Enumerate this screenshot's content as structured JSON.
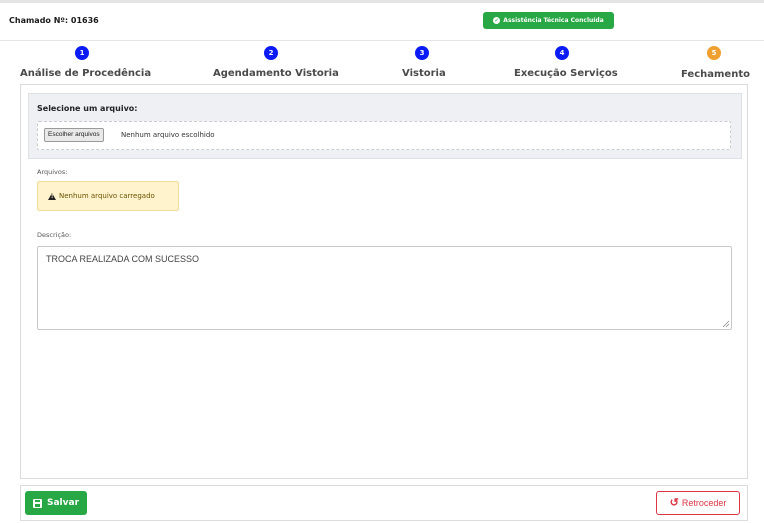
{
  "header": {
    "chamado": "Chamado Nº: 01636",
    "status_badge": "Assistência Técnica Concluída"
  },
  "steps": [
    {
      "number": "1",
      "label": "Análise de Procedência",
      "color": "#0a1bf5"
    },
    {
      "number": "2",
      "label": "Agendamento Vistoria",
      "color": "#0a1bf5"
    },
    {
      "number": "3",
      "label": "Vistoria",
      "color": "#0a1bf5"
    },
    {
      "number": "4",
      "label": "Execução Serviços",
      "color": "#0a1bf5"
    },
    {
      "number": "5",
      "label": "Fechamento",
      "color": "#f0a030"
    }
  ],
  "upload": {
    "title": "Selecione um arquivo:",
    "button_label": "Escolher arquivos",
    "file_status": "Nenhum arquivo escolhido"
  },
  "files": {
    "label": "Arquivos:",
    "empty_message": "Nenhum arquivo carregado"
  },
  "description": {
    "label": "Descrição:",
    "value": "TROCA REALIZADA COM SUCESSO"
  },
  "footer": {
    "save_label": "Salvar",
    "back_label": "Retroceder"
  },
  "colors": {
    "success": "#28a745",
    "danger": "#dc3545",
    "step_active": "#0a1bf5",
    "step_current": "#f0a030"
  }
}
